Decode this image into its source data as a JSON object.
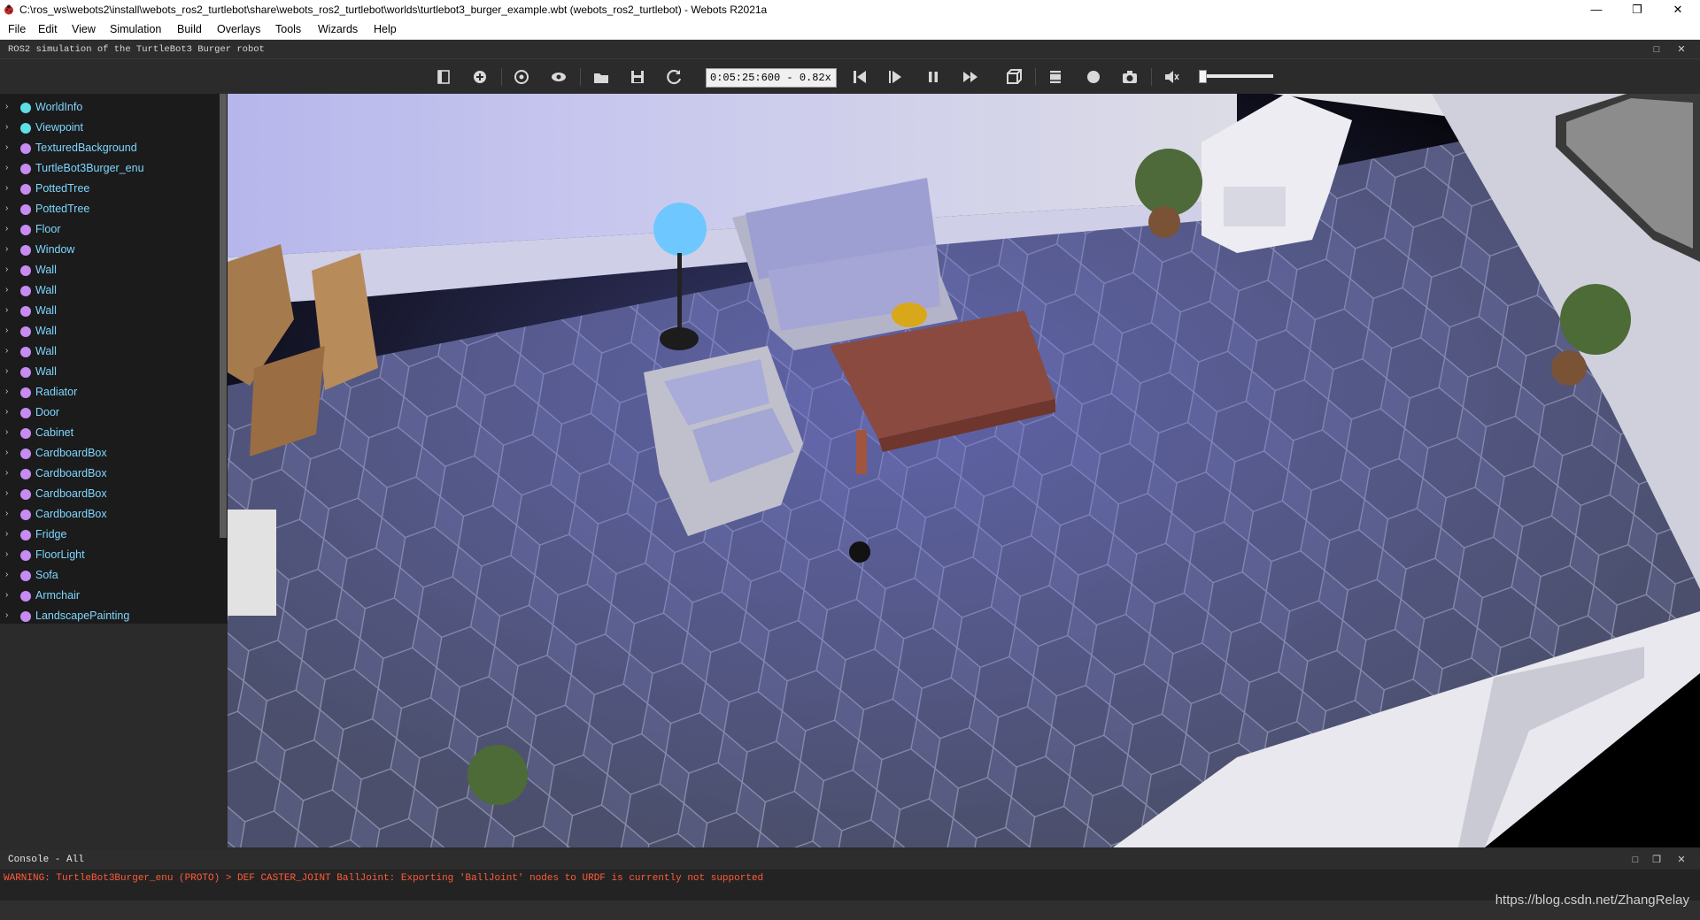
{
  "window": {
    "title": "C:\\ros_ws\\webots2\\install\\webots_ros2_turtlebot\\share\\webots_ros2_turtlebot\\worlds\\turtlebot3_burger_example.wbt (webots_ros2_turtlebot) - Webots R2021a",
    "icon": "webots-ladybug-icon",
    "controls": {
      "minimize": "—",
      "restore": "❐",
      "close": "✕"
    }
  },
  "menubar": [
    "File",
    "Edit",
    "View",
    "Simulation",
    "Build",
    "Overlays",
    "Tools",
    "Wizards",
    "Help"
  ],
  "header": {
    "description": "ROS2 simulation of the TurtleBot3 Burger robot"
  },
  "toolbar": {
    "time": "0:05:25:600",
    "speed": "0.82x",
    "time_display": "0:05:25:600  -  0.82x",
    "volume_level": 0.0,
    "icons": [
      "hide-scene-tree-icon",
      "add-node-icon",
      "reset-view-icon",
      "viewpoint-icon",
      "open-world-icon",
      "save-world-icon",
      "reload-world-icon",
      "reset-simulation-icon",
      "step-icon",
      "pause-icon",
      "fast-forward-icon",
      "rendering-icon",
      "record-movie-icon",
      "record-animation-icon",
      "screenshot-icon",
      "mute-icon"
    ]
  },
  "scene_tree": {
    "items": [
      {
        "label": "WorldInfo",
        "color": "#5ce0e6"
      },
      {
        "label": "Viewpoint",
        "color": "#5ce0e6"
      },
      {
        "label": "TexturedBackground",
        "color": "#c68cf2"
      },
      {
        "label": "TurtleBot3Burger_enu",
        "color": "#c68cf2"
      },
      {
        "label": "PottedTree",
        "color": "#c68cf2"
      },
      {
        "label": "PottedTree",
        "color": "#c68cf2"
      },
      {
        "label": "Floor",
        "color": "#c68cf2"
      },
      {
        "label": "Window",
        "color": "#c68cf2"
      },
      {
        "label": "Wall",
        "color": "#c68cf2"
      },
      {
        "label": "Wall",
        "color": "#c68cf2"
      },
      {
        "label": "Wall",
        "color": "#c68cf2"
      },
      {
        "label": "Wall",
        "color": "#c68cf2"
      },
      {
        "label": "Wall",
        "color": "#c68cf2"
      },
      {
        "label": "Wall",
        "color": "#c68cf2"
      },
      {
        "label": "Radiator",
        "color": "#c68cf2"
      },
      {
        "label": "Door",
        "color": "#c68cf2"
      },
      {
        "label": "Cabinet",
        "color": "#c68cf2"
      },
      {
        "label": "CardboardBox",
        "color": "#c68cf2"
      },
      {
        "label": "CardboardBox",
        "color": "#c68cf2"
      },
      {
        "label": "CardboardBox",
        "color": "#c68cf2"
      },
      {
        "label": "CardboardBox",
        "color": "#c68cf2"
      },
      {
        "label": "Fridge",
        "color": "#c68cf2"
      },
      {
        "label": "FloorLight",
        "color": "#c68cf2"
      },
      {
        "label": "Sofa",
        "color": "#c68cf2"
      },
      {
        "label": "Armchair",
        "color": "#c68cf2"
      },
      {
        "label": "LandscapePainting",
        "color": "#c68cf2"
      }
    ]
  },
  "console": {
    "title": "Console - All",
    "messages": [
      "WARNING: TurtleBot3Burger_enu (PROTO) > DEF CASTER_JOINT BallJoint: Exporting 'BallJoint' nodes to URDF is currently not supported"
    ]
  },
  "watermark": "https://blog.csdn.net/ZhangRelay",
  "colors": {
    "tree_text": "#7fd6ff",
    "warning": "#ff5b3a",
    "panel_bg": "#2b2b2b"
  }
}
